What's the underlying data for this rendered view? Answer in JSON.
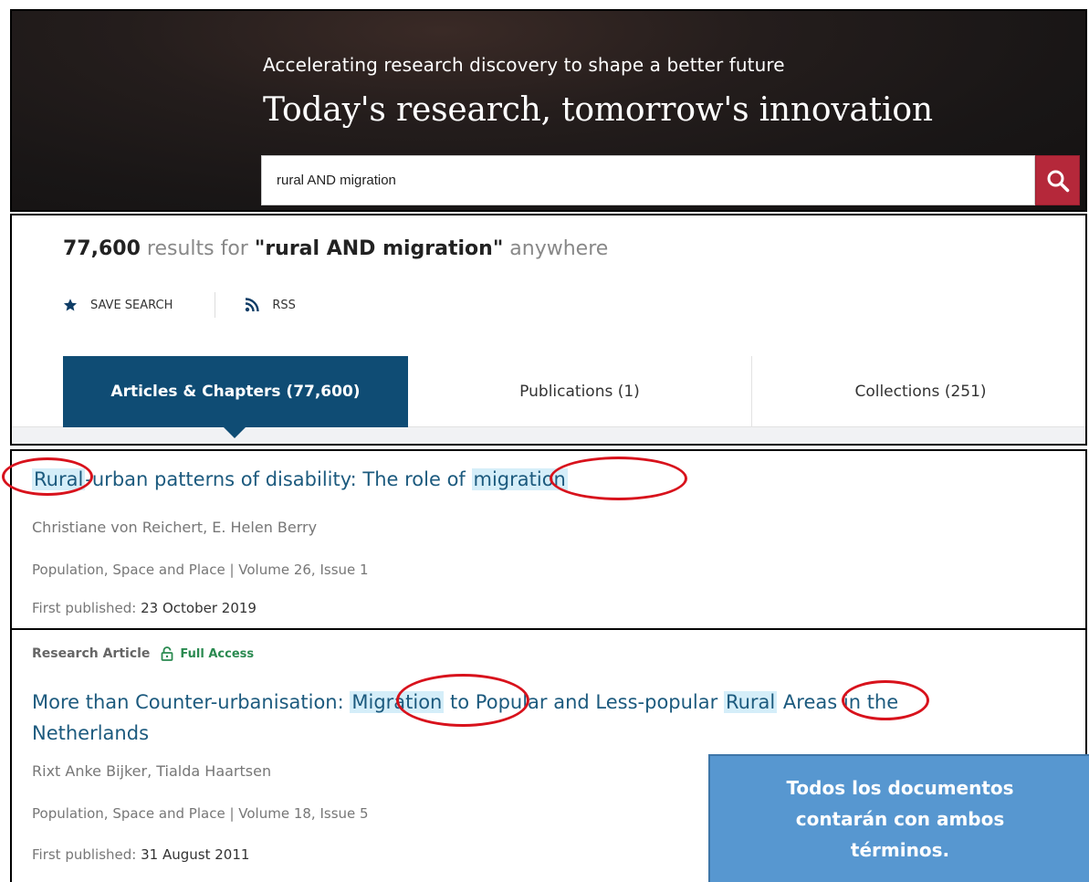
{
  "hero": {
    "tagline": "Accelerating research discovery to shape a better future",
    "title": "Today's research, tomorrow's innovation",
    "search_value": "rural AND migration",
    "search_icon": "search-icon",
    "search_button_color": "#b5283a"
  },
  "results": {
    "count": "77,600",
    "text_results_for": "results for",
    "query": "\"rural AND migration\"",
    "scope": "anywhere",
    "actions": {
      "save_search": "SAVE SEARCH",
      "rss": "RSS"
    },
    "tabs": [
      {
        "label": "Articles & Chapters (77,600)",
        "active": true
      },
      {
        "label": "Publications (1)",
        "active": false
      },
      {
        "label": "Collections (251)",
        "active": false
      }
    ],
    "active_tab_color": "#0f4c74"
  },
  "items": [
    {
      "title_hl1": "Rural",
      "title_mid": "-urban patterns of disability: The role of ",
      "title_hl2": "migration",
      "authors": "Christiane von Reichert, E. Helen Berry",
      "journal": "Population, Space and Place | Volume 26, Issue 1",
      "published_label": "First published:",
      "published_date": "23 October 2019"
    },
    {
      "type": "Research Article",
      "access": "Full Access",
      "title_pre": "More than Counter-urbanisation: ",
      "title_hl1": "Migration",
      "title_mid": " to Popular and Less-popular ",
      "title_hl2": "Rural",
      "title_post": " Areas in the",
      "title_line2": "Netherlands",
      "authors": "Rixt Anke Bijker, Tialda Haartsen",
      "journal": "Population, Space and Place | Volume 18, Issue 5",
      "published_label": "First published:",
      "published_date": "31 August 2011"
    }
  ],
  "callout": {
    "text": "Todos los documentos contarán con ambos términos.",
    "color": "#5797d0"
  },
  "annotation_color": "#d8121c",
  "highlight_color": "#d5eef9"
}
